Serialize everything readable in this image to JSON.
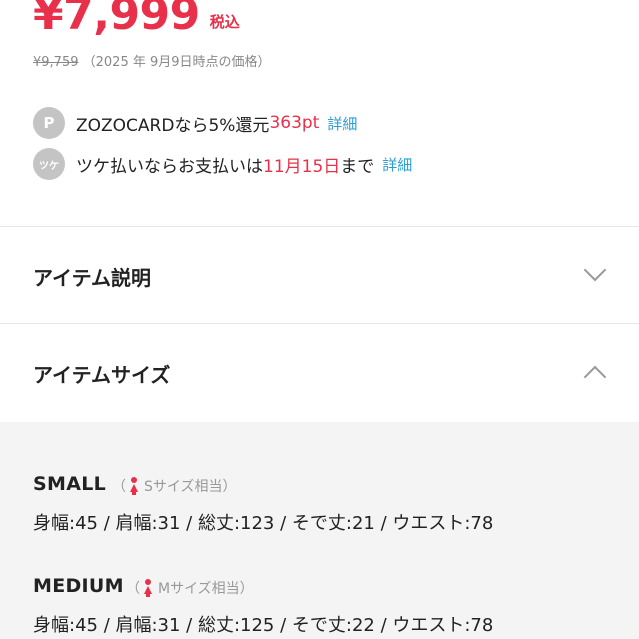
{
  "price": {
    "current": "¥7,999",
    "tax_label": "税込",
    "original": "¥9,759",
    "original_note": "（2025 年 9月9日時点の価格）"
  },
  "promos": {
    "zozocard": {
      "icon_text": "P",
      "text_before": "ZOZOCARDなら5%還元 ",
      "points": "363pt",
      "link": "詳細"
    },
    "tsuke": {
      "icon_text": "ツケ",
      "text_before": "ツケ払いならお支払いは",
      "date": "11月15日",
      "text_after": "まで",
      "link": "詳細"
    }
  },
  "sections": {
    "description": {
      "title": "アイテム説明",
      "icon": "chevron-down-icon"
    },
    "size": {
      "title": "アイテムサイズ",
      "icon": "chevron-up-icon"
    }
  },
  "sizes": [
    {
      "name": "SMALL",
      "equiv": "Sサイズ相当",
      "measurements": "身幅:45 / 肩幅:31 / 総丈:123 / そで丈:21 / ウエスト:78"
    },
    {
      "name": "MEDIUM",
      "equiv": "Mサイズ相当",
      "measurements": "身幅:45 / 肩幅:31 / 総丈:125 / そで丈:22 / ウエスト:78"
    }
  ],
  "colors": {
    "accent_red": "#e8304a",
    "link_blue": "#2a9fd6",
    "icon_gray": "#c4c4c4"
  }
}
